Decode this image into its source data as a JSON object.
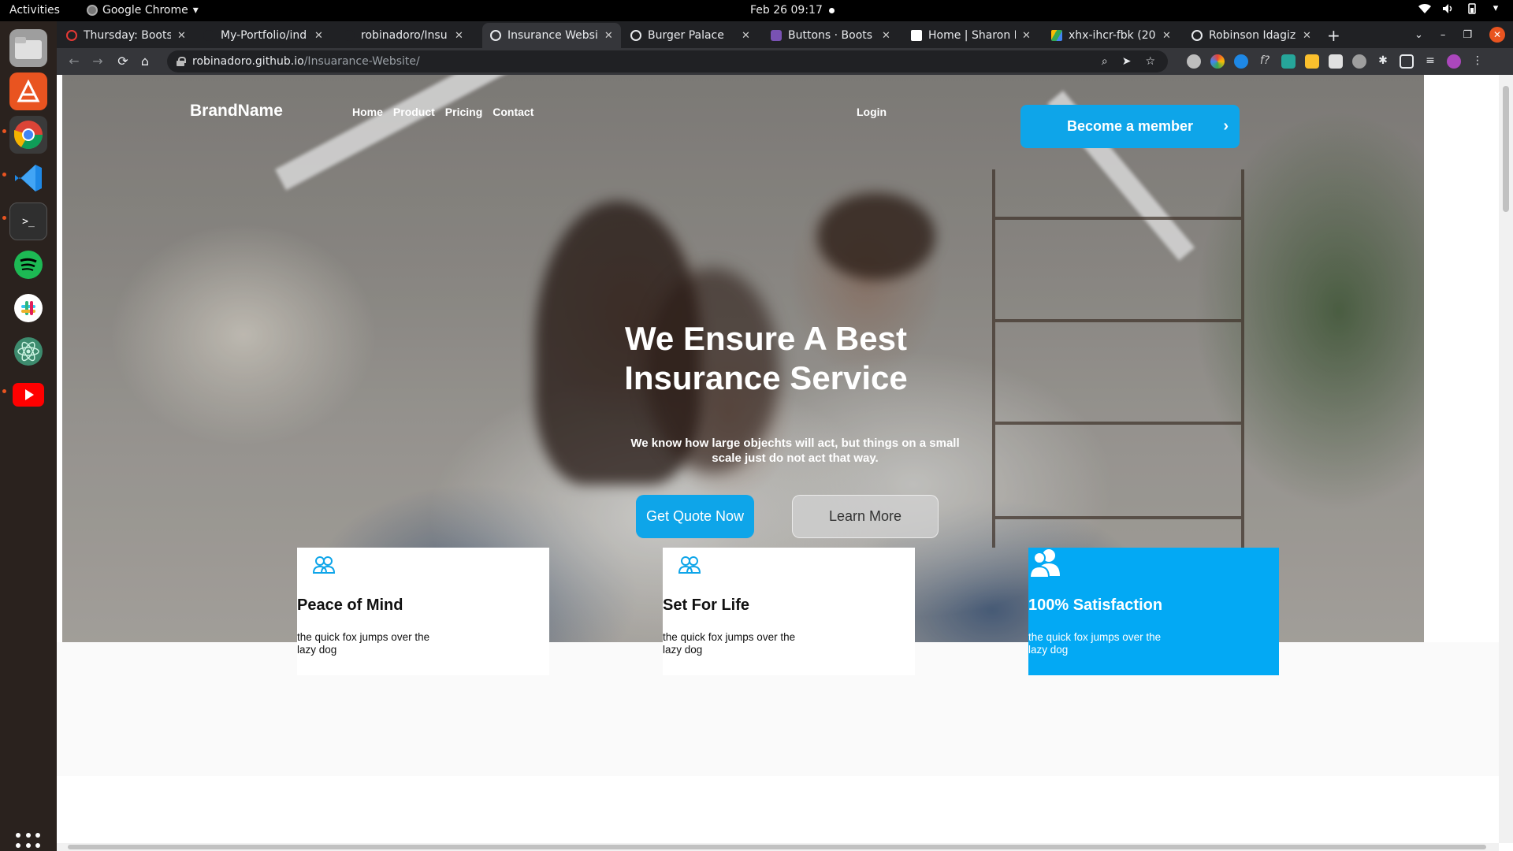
{
  "system": {
    "activities": "Activities",
    "app_name": "Google Chrome",
    "clock": "Feb 26  09:17"
  },
  "browser": {
    "tabs": [
      {
        "title": "Thursday: Boots",
        "favicon_color": "#e53935"
      },
      {
        "title": "My-Portfolio/ind",
        "favicon_color": "#202124"
      },
      {
        "title": "robinadoro/Insu",
        "favicon_color": "#202124"
      },
      {
        "title": "Insurance Websi",
        "favicon_color": "#e8eaed"
      },
      {
        "title": "Burger Palace",
        "favicon_color": "#e8eaed"
      },
      {
        "title": "Buttons · Boots",
        "favicon_color": "#7952b3"
      },
      {
        "title": "Home | Sharon E",
        "favicon_color": "#ffffff"
      },
      {
        "title": "xhx-ihcr-fbk (202",
        "favicon_color": "#34a853"
      },
      {
        "title": "Robinson Idagiz",
        "favicon_color": "#e8eaed"
      }
    ],
    "active_tab_index": 3,
    "url_host": "robinadoro.github.io",
    "url_path": "/Insuarance-Website/"
  },
  "site": {
    "brand": "BrandName",
    "nav": [
      "Home",
      "Product",
      "Pricing",
      "Contact"
    ],
    "login": "Login",
    "member_button": "Become a member",
    "headline": "We Ensure A Best Insurance Service",
    "subtext": "We know how large objechts will act, but things on a small scale just do not act that way.",
    "cta_primary": "Get Quote Now",
    "cta_secondary": "Learn More",
    "accent_color": "#0ea5e9",
    "features": [
      {
        "title": "Peace of Mind",
        "text": "the quick fox jumps over the lazy dog",
        "icon": "users-icon"
      },
      {
        "title": "Set For Life",
        "text": "the quick fox jumps over the lazy dog",
        "icon": "users-icon"
      },
      {
        "title": "100% Satisfaction",
        "text": "the quick fox jumps over the lazy dog",
        "icon": "user-group-icon"
      }
    ]
  }
}
